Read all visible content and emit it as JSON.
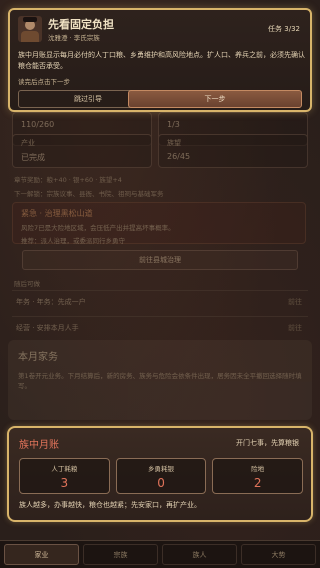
{
  "guide": {
    "title": "先看固定负担",
    "subtitle": "沈雅澄 · 李氏宗族",
    "task": "任务 3/32",
    "body": "族中月账显示每月必付的人丁口粮、乡勇维护和高风险地点。扩人口、养兵之前，必须先确认粮仓能否承受。",
    "hint": "读完后点击下一步",
    "skip_label": "跳过引导",
    "next_label": "下一步"
  },
  "underlay": {
    "stat1_value": "110/260",
    "stat2_value": "1/3",
    "stat3_label": "产业",
    "stat3_value": "已完成",
    "stat4_label": "族望",
    "stat4_value": "26/45",
    "line1": "章节奖励：粮+40 · 银+60 · 族望+4",
    "line2": "下一解锁：宗族议事、县衙、书院、祖祠与基础军务",
    "urgent_title": "紧急 · 治理黑松山道",
    "urgent_desc": "风险7已是大险地区域，会压低产出并提高坏事概率。",
    "urgent_action": "推荐：派人治理，或委派同行乡勇守",
    "go_button": "前往县城治理",
    "section_label": "随后可做",
    "row1_label": "年务 · 年务：先成一户",
    "row1_action": "前往",
    "row2_label": "经营 · 安排本月人手",
    "row2_action": "前往",
    "month_title": "本月家务",
    "month_desc": "第1卷开元业务。下月结算后，新的房务、族务与危险会依条件出现，居务因未全平撤回选择随时填写。"
  },
  "ledger": {
    "title": "族中月账",
    "status": "开门七事，先算粮银",
    "cells": [
      {
        "label": "人丁耗粮",
        "value": "3"
      },
      {
        "label": "乡勇耗银",
        "value": "0"
      },
      {
        "label": "险地",
        "value": "2"
      }
    ],
    "footer": "族人越多，办事越快，粮仓也越紧；先安家口，再扩产业。"
  },
  "nav": [
    "家业",
    "宗族",
    "族人",
    "大势"
  ],
  "colors": {
    "accent_gold": "#d8b46a",
    "alert_red": "#e0735a"
  }
}
